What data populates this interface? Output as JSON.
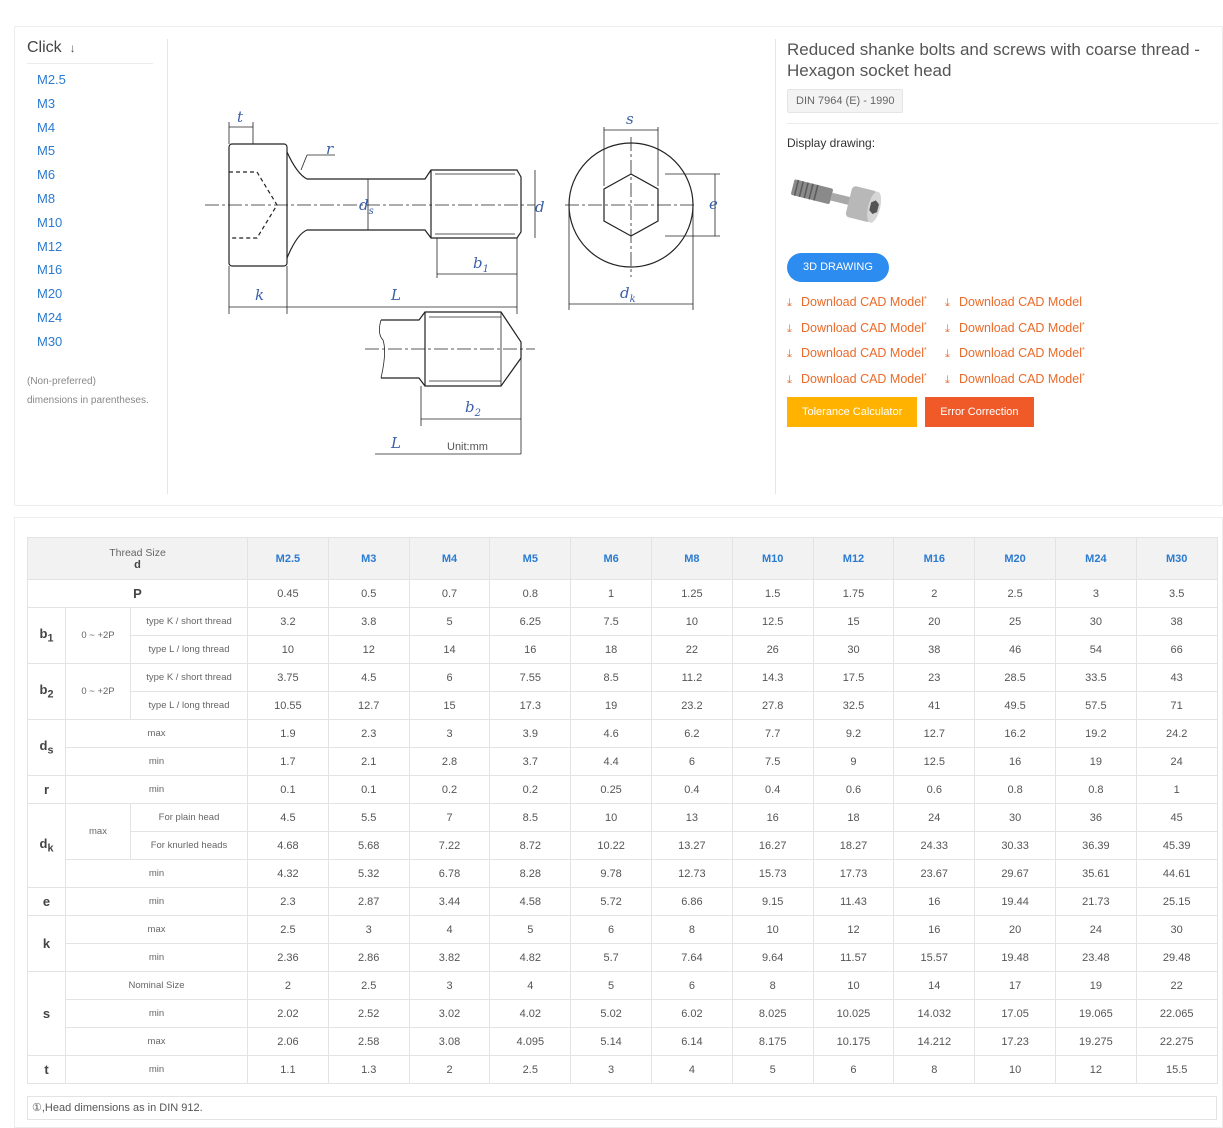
{
  "sidebar": {
    "title": "Click",
    "items": [
      "M2.5",
      "M3",
      "M4",
      "M5",
      "M6",
      "M8",
      "M10",
      "M12",
      "M16",
      "M20",
      "M24",
      "M30"
    ],
    "note_line1": "(Non-preferred)",
    "note_line2": "dimensions in parentheses."
  },
  "drawing": {
    "labels": {
      "t": "t",
      "r": "r",
      "ds": "ds",
      "d": "d",
      "s": "s",
      "e": "e",
      "b1": "b1",
      "k": "k",
      "L": "L",
      "dk": "dk",
      "b2": "b2",
      "L2": "L"
    },
    "unit": "Unit:mm"
  },
  "product": {
    "title": "Reduced shanke bolts and screws with coarse thread - Hexagon socket head",
    "standard": "DIN 7964 (E) - 1990",
    "display_label": "Display drawing:",
    "btn_3d": "3D DRAWING",
    "downloads": [
      {
        "label": "Download CAD Model",
        "mark": "*"
      },
      {
        "label": "Download CAD Model",
        "mark": ""
      },
      {
        "label": "Download CAD Model",
        "mark": "*"
      },
      {
        "label": "Download CAD Model",
        "mark": "*"
      },
      {
        "label": "Download CAD Model",
        "mark": "*"
      },
      {
        "label": "Download CAD Model",
        "mark": "*"
      },
      {
        "label": "Download CAD Model",
        "mark": "*"
      },
      {
        "label": "Download CAD Model",
        "mark": "*"
      }
    ],
    "btn_tolerance": "Tolerance Calculator",
    "btn_error": "Error Correction"
  },
  "table": {
    "header_line1": "Thread Size",
    "header_line2": "d",
    "sizes": [
      "M2.5",
      "M3",
      "M4",
      "M5",
      "M6",
      "M8",
      "M10",
      "M12",
      "M16",
      "M20",
      "M24",
      "M30"
    ],
    "rows": [
      {
        "name": "P",
        "values": [
          "0.45",
          "0.5",
          "0.7",
          "0.8",
          "1",
          "1.25",
          "1.5",
          "1.75",
          "2",
          "2.5",
          "3",
          "3.5"
        ]
      },
      {
        "name": "b1",
        "range": "0 ~ +2P",
        "sub": "type K / short thread",
        "values": [
          "3.2",
          "3.8",
          "5",
          "6.25",
          "7.5",
          "10",
          "12.5",
          "15",
          "20",
          "25",
          "30",
          "38"
        ]
      },
      {
        "sub": "type L / long thread",
        "values": [
          "10",
          "12",
          "14",
          "16",
          "18",
          "22",
          "26",
          "30",
          "38",
          "46",
          "54",
          "66"
        ]
      },
      {
        "name": "b2",
        "range": "0 ~ +2P",
        "sub": "type K / short thread",
        "values": [
          "3.75",
          "4.5",
          "6",
          "7.55",
          "8.5",
          "11.2",
          "14.3",
          "17.5",
          "23",
          "28.5",
          "33.5",
          "43"
        ]
      },
      {
        "sub": "type L / long thread",
        "values": [
          "10.55",
          "12.7",
          "15",
          "17.3",
          "19",
          "23.2",
          "27.8",
          "32.5",
          "41",
          "49.5",
          "57.5",
          "71"
        ]
      },
      {
        "name": "ds",
        "sub": "max",
        "values": [
          "1.9",
          "2.3",
          "3",
          "3.9",
          "4.6",
          "6.2",
          "7.7",
          "9.2",
          "12.7",
          "16.2",
          "19.2",
          "24.2"
        ]
      },
      {
        "sub": "min",
        "values": [
          "1.7",
          "2.1",
          "2.8",
          "3.7",
          "4.4",
          "6",
          "7.5",
          "9",
          "12.5",
          "16",
          "19",
          "24"
        ]
      },
      {
        "name": "r",
        "sub": "min",
        "values": [
          "0.1",
          "0.1",
          "0.2",
          "0.2",
          "0.25",
          "0.4",
          "0.4",
          "0.6",
          "0.6",
          "0.8",
          "0.8",
          "1"
        ]
      },
      {
        "name": "dk",
        "range": "max",
        "sub": "For plain head",
        "values": [
          "4.5",
          "5.5",
          "7",
          "8.5",
          "10",
          "13",
          "16",
          "18",
          "24",
          "30",
          "36",
          "45"
        ]
      },
      {
        "sub": "For knurled heads",
        "values": [
          "4.68",
          "5.68",
          "7.22",
          "8.72",
          "10.22",
          "13.27",
          "16.27",
          "18.27",
          "24.33",
          "30.33",
          "36.39",
          "45.39"
        ]
      },
      {
        "sub": "min",
        "values": [
          "4.32",
          "5.32",
          "6.78",
          "8.28",
          "9.78",
          "12.73",
          "15.73",
          "17.73",
          "23.67",
          "29.67",
          "35.61",
          "44.61"
        ]
      },
      {
        "name": "e",
        "sub": "min",
        "values": [
          "2.3",
          "2.87",
          "3.44",
          "4.58",
          "5.72",
          "6.86",
          "9.15",
          "11.43",
          "16",
          "19.44",
          "21.73",
          "25.15"
        ]
      },
      {
        "name": "k",
        "sub": "max",
        "values": [
          "2.5",
          "3",
          "4",
          "5",
          "6",
          "8",
          "10",
          "12",
          "16",
          "20",
          "24",
          "30"
        ]
      },
      {
        "sub": "min",
        "values": [
          "2.36",
          "2.86",
          "3.82",
          "4.82",
          "5.7",
          "7.64",
          "9.64",
          "11.57",
          "15.57",
          "19.48",
          "23.48",
          "29.48"
        ]
      },
      {
        "name": "s",
        "sub": "Nominal Size",
        "values": [
          "2",
          "2.5",
          "3",
          "4",
          "5",
          "6",
          "8",
          "10",
          "14",
          "17",
          "19",
          "22"
        ]
      },
      {
        "sub": "min",
        "values": [
          "2.02",
          "2.52",
          "3.02",
          "4.02",
          "5.02",
          "6.02",
          "8.025",
          "10.025",
          "14.032",
          "17.05",
          "19.065",
          "22.065"
        ]
      },
      {
        "sub": "max",
        "values": [
          "2.06",
          "2.58",
          "3.08",
          "4.095",
          "5.14",
          "6.14",
          "8.175",
          "10.175",
          "14.212",
          "17.23",
          "19.275",
          "22.275"
        ]
      },
      {
        "name": "t",
        "sub": "min",
        "values": [
          "1.1",
          "1.3",
          "2",
          "2.5",
          "3",
          "4",
          "5",
          "6",
          "8",
          "10",
          "12",
          "15.5"
        ]
      }
    ],
    "footnote": "①,Head dimensions as in DIN 912."
  }
}
